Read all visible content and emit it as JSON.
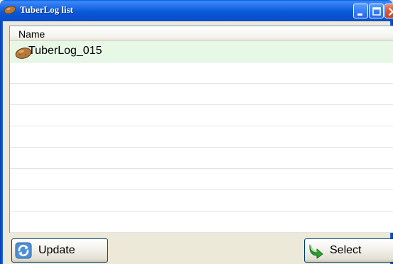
{
  "window": {
    "title": "TuberLog list",
    "icon": "potato-icon",
    "title_color": "#ffffff",
    "titlebar_color": "#0a5ad9"
  },
  "list": {
    "column_header": "Name",
    "rows": [
      {
        "label": "TuberLog_015",
        "icon": "potato-icon",
        "selected": true
      }
    ],
    "selected_row_color": "#e8f8e6"
  },
  "buttons": {
    "update_label": "Update",
    "update_icon": "refresh-icon",
    "select_label": "Select",
    "select_icon": "green-arrow-icon"
  }
}
